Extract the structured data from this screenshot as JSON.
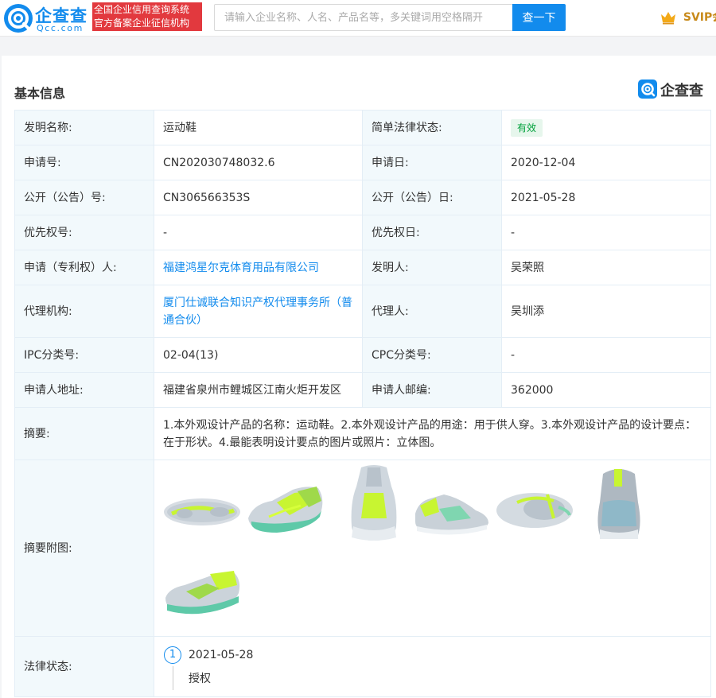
{
  "header": {
    "logo_name": "企查查",
    "logo_domain": "Qcc.com",
    "tagline_line1": "全国企业信用查询系统",
    "tagline_line2": "官方备案企业征信机构",
    "search_placeholder": "请输入企业名称、人名、产品名等，多关键词用空格隔开",
    "search_button": "查一下",
    "svip_label": "SVIP会"
  },
  "section": {
    "title": "基本信息",
    "brand": "企查查"
  },
  "rows": {
    "invention_name_label": "发明名称:",
    "invention_name": "运动鞋",
    "legal_status_label": "简单法律状态:",
    "legal_status": "有效",
    "app_no_label": "申请号:",
    "app_no": "CN202030748032.6",
    "app_date_label": "申请日:",
    "app_date": "2020-12-04",
    "pub_no_label": "公开（公告）号:",
    "pub_no": "CN306566353S",
    "pub_date_label": "公开（公告）日:",
    "pub_date": "2021-05-28",
    "priority_no_label": "优先权号:",
    "priority_no": "-",
    "priority_date_label": "优先权日:",
    "priority_date": "-",
    "applicant_label": "申请（专利权）人:",
    "applicant": "福建鸿星尔克体育用品有限公司",
    "inventor_label": "发明人:",
    "inventor": "吴荣照",
    "agency_label": "代理机构:",
    "agency": "厦门仕诚联合知识产权代理事务所（普通合伙）",
    "agent_label": "代理人:",
    "agent": "吴圳添",
    "ipc_label": "IPC分类号:",
    "ipc": "02-04(13)",
    "cpc_label": "CPC分类号:",
    "cpc": "-",
    "address_label": "申请人地址:",
    "address": "福建省泉州市鲤城区江南火炬开发区",
    "postcode_label": "申请人邮编:",
    "postcode": "362000",
    "abstract_label": "摘要:",
    "abstract": "1.本外观设计产品的名称：运动鞋。2.本外观设计产品的用途：用于供人穿。3.本外观设计产品的设计要点：在于形状。4.最能表明设计要点的图片或照片：立体图。",
    "abstract_images_label": "摘要附图:",
    "legal_label": "法律状态:",
    "legal_index": "1",
    "legal_date": "2021-05-28",
    "legal_event": "授权"
  },
  "colors": {
    "brand_blue": "#128bed",
    "tagline_red": "#e2393e",
    "label_bg": "#f2f9fc",
    "badge_green": "#00a13b",
    "shoe_lime": "#c8f531",
    "shoe_grey": "#b9c3cc"
  },
  "icons": {
    "logo": "qcc-logo-icon",
    "svip": "crown-icon"
  }
}
